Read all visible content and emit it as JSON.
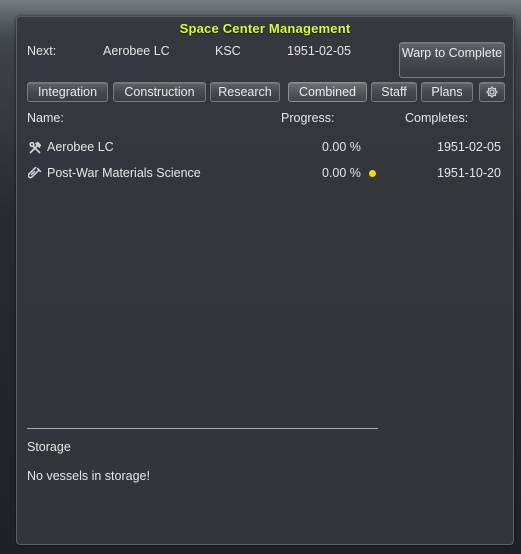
{
  "window": {
    "title": "Space Center Management"
  },
  "next_bar": {
    "label": "Next:",
    "item": "Aerobee LC",
    "site": "KSC",
    "date": "1951-02-05",
    "warp_button": "Warp to Complete"
  },
  "tabs": [
    {
      "label": "Integration"
    },
    {
      "label": "Construction"
    },
    {
      "label": "Research"
    },
    {
      "label": "Combined",
      "active": true
    },
    {
      "label": "Staff"
    },
    {
      "label": "Plans"
    }
  ],
  "settings_icon": "gear-icon",
  "columns": {
    "name": "Name:",
    "progress": "Progress:",
    "completes": "Completes:"
  },
  "rows": [
    {
      "icon": "wrench-hammer-icon",
      "name": "Aerobee LC",
      "progress": "0.00 %",
      "completes": "1951-02-05",
      "status_dot": false
    },
    {
      "icon": "test-tube-icon",
      "name": "Post-War Materials Science",
      "progress": "0.00 %",
      "completes": "1951-10-20",
      "status_dot": true
    }
  ],
  "storage": {
    "heading": "Storage",
    "empty_text": "No vessels in storage!"
  },
  "colors": {
    "title": "#d7ff2a",
    "status_dot": "#f5d90a",
    "text": "#e6e6e6"
  }
}
